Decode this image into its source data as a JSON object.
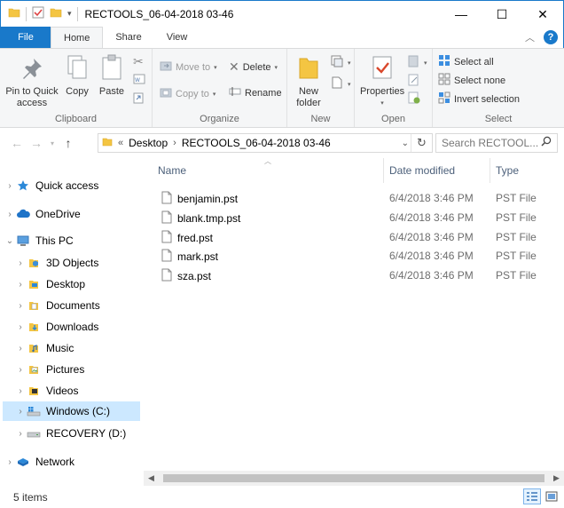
{
  "window": {
    "title": "RECTOOLS_06-04-2018 03-46",
    "minimize_glyph": "—",
    "maximize_glyph": "☐",
    "close_glyph": "✕"
  },
  "tabs": [
    {
      "label": "File"
    },
    {
      "label": "Home"
    },
    {
      "label": "Share"
    },
    {
      "label": "View"
    }
  ],
  "ribbon": {
    "clipboard": {
      "label": "Clipboard",
      "pin_line1": "Pin to Quick",
      "pin_line2": "access",
      "copy": "Copy",
      "paste": "Paste"
    },
    "organize": {
      "label": "Organize",
      "move_to": "Move to",
      "copy_to": "Copy to",
      "delete": "Delete",
      "rename": "Rename"
    },
    "new": {
      "label": "New",
      "new_folder_line1": "New",
      "new_folder_line2": "folder"
    },
    "open": {
      "label": "Open",
      "properties": "Properties"
    },
    "select": {
      "label": "Select",
      "select_all": "Select all",
      "select_none": "Select none",
      "invert_selection": "Invert selection"
    }
  },
  "address": {
    "overflow": "«",
    "crumbs": [
      "Desktop",
      "RECTOOLS_06-04-2018 03-46"
    ],
    "search_placeholder": "Search RECTOOL..."
  },
  "nav": [
    {
      "label": "Quick access",
      "icon": "star-icon"
    },
    {
      "label": "OneDrive",
      "icon": "cloud-icon"
    },
    {
      "label": "This PC",
      "icon": "computer-icon"
    },
    {
      "label": "3D Objects",
      "icon": "3d-objects-icon"
    },
    {
      "label": "Desktop",
      "icon": "desktop-icon"
    },
    {
      "label": "Documents",
      "icon": "documents-icon"
    },
    {
      "label": "Downloads",
      "icon": "downloads-icon"
    },
    {
      "label": "Music",
      "icon": "music-icon"
    },
    {
      "label": "Pictures",
      "icon": "pictures-icon"
    },
    {
      "label": "Videos",
      "icon": "videos-icon"
    },
    {
      "label": "Windows (C:)",
      "icon": "drive-c-icon"
    },
    {
      "label": "RECOVERY (D:)",
      "icon": "drive-d-icon"
    },
    {
      "label": "Network",
      "icon": "network-icon"
    }
  ],
  "columns": {
    "name": "Name",
    "date": "Date modified",
    "type": "Type"
  },
  "files": [
    {
      "name": "benjamin.pst",
      "date": "6/4/2018 3:46 PM",
      "type": "PST File"
    },
    {
      "name": "blank.tmp.pst",
      "date": "6/4/2018 3:46 PM",
      "type": "PST File"
    },
    {
      "name": "fred.pst",
      "date": "6/4/2018 3:46 PM",
      "type": "PST File"
    },
    {
      "name": "mark.pst",
      "date": "6/4/2018 3:46 PM",
      "type": "PST File"
    },
    {
      "name": "sza.pst",
      "date": "6/4/2018 3:46 PM",
      "type": "PST File"
    }
  ],
  "status": {
    "items": "5 items"
  },
  "colors": {
    "accent": "#1979ca",
    "selection": "#cce8ff",
    "folder": "#f4c542"
  }
}
